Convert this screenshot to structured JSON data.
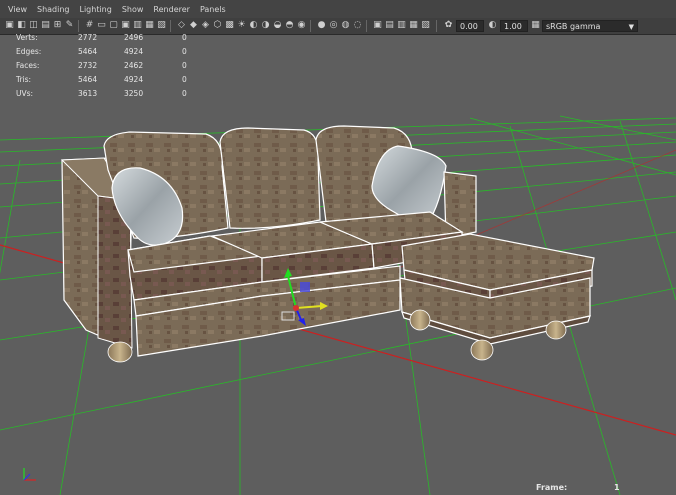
{
  "menu": [
    "View",
    "Shading",
    "Lighting",
    "Show",
    "Renderer",
    "Panels"
  ],
  "toolbar": {
    "exposure": "0.00",
    "gamma": "1.00",
    "color_space": "sRGB gamma"
  },
  "hud": {
    "rows": [
      {
        "label": "Verts:",
        "v1": "2772",
        "v2": "2496",
        "v3": "0"
      },
      {
        "label": "Edges:",
        "v1": "5464",
        "v2": "4924",
        "v3": "0"
      },
      {
        "label": "Faces:",
        "v1": "2732",
        "v2": "2462",
        "v3": "0"
      },
      {
        "label": "Tris:",
        "v1": "5464",
        "v2": "4924",
        "v3": "0"
      },
      {
        "label": "UVs:",
        "v1": "3613",
        "v2": "3250",
        "v3": "0"
      }
    ]
  },
  "frame": {
    "label": "Frame:",
    "value": "1"
  },
  "colors": {
    "viewport_bg": "#5d5d5d",
    "grid_green": "#22cc22",
    "axis_red": "#c02020",
    "fabric": "#7a6a56",
    "wireframe": "#ffffff"
  }
}
